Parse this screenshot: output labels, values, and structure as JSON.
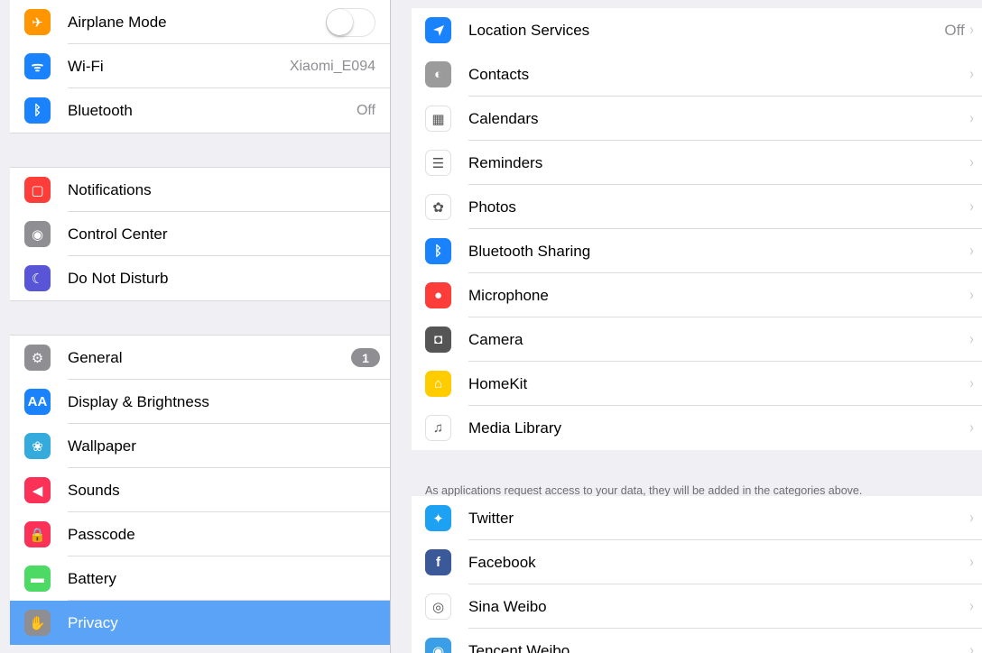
{
  "sidebar": {
    "group1": [
      {
        "label": "Airplane Mode",
        "icon": "airplane-icon",
        "color": "#ff9500",
        "glyph": "✈"
      },
      {
        "label": "Wi-Fi",
        "icon": "wifi-icon",
        "color": "#1a82fb",
        "glyph": "ᯤ",
        "value": "Xiaomi_E094"
      },
      {
        "label": "Bluetooth",
        "icon": "bluetooth-icon",
        "color": "#1a82fb",
        "glyph": "ᛒ",
        "value": "Off"
      }
    ],
    "group2": [
      {
        "label": "Notifications",
        "icon": "notifications-icon",
        "color": "#fc3d39",
        "glyph": "▢"
      },
      {
        "label": "Control Center",
        "icon": "control-center-icon",
        "color": "#8e8e93",
        "glyph": "◉"
      },
      {
        "label": "Do Not Disturb",
        "icon": "moon-icon",
        "color": "#5856d6",
        "glyph": "☾"
      }
    ],
    "group3": [
      {
        "label": "General",
        "icon": "gear-icon",
        "color": "#8e8e93",
        "glyph": "⚙",
        "badge": "1"
      },
      {
        "label": "Display & Brightness",
        "icon": "display-brightness-icon",
        "color": "#1a82fb",
        "glyph": "AA"
      },
      {
        "label": "Wallpaper",
        "icon": "wallpaper-icon",
        "color": "#35aadc",
        "glyph": "❀"
      },
      {
        "label": "Sounds",
        "icon": "speaker-icon",
        "color": "#fc3158",
        "glyph": "◀"
      },
      {
        "label": "Passcode",
        "icon": "lock-icon",
        "color": "#fc3158",
        "glyph": "🔒"
      },
      {
        "label": "Battery",
        "icon": "battery-icon",
        "color": "#4cd964",
        "glyph": "▬"
      },
      {
        "label": "Privacy",
        "icon": "hand-icon",
        "color": "#8e8e93",
        "glyph": "✋"
      }
    ]
  },
  "detail": {
    "location_services": {
      "label": "Location Services",
      "value": "Off"
    },
    "list": [
      {
        "label": "Contacts",
        "icon": "contacts-icon",
        "color": "#9b9b9b",
        "glyph": "◐"
      },
      {
        "label": "Calendars",
        "icon": "calendar-icon",
        "color": "#ffffff",
        "glyph": "▦"
      },
      {
        "label": "Reminders",
        "icon": "reminders-icon",
        "color": "#ffffff",
        "glyph": "☰"
      },
      {
        "label": "Photos",
        "icon": "photos-icon",
        "color": "#ffffff",
        "glyph": "✿"
      },
      {
        "label": "Bluetooth Sharing",
        "icon": "bluetooth-icon",
        "color": "#1a82fb",
        "glyph": "ᛒ"
      },
      {
        "label": "Microphone",
        "icon": "microphone-icon",
        "color": "#fc3d39",
        "glyph": "●"
      },
      {
        "label": "Camera",
        "icon": "camera-icon",
        "color": "#555555",
        "glyph": "◘"
      },
      {
        "label": "HomeKit",
        "icon": "homekit-icon",
        "color": "#ffcc00",
        "glyph": "⌂"
      },
      {
        "label": "Media Library",
        "icon": "music-icon",
        "color": "#ffffff",
        "glyph": "♫"
      }
    ],
    "footnote": "As applications request access to your data, they will be added in the categories above.",
    "social": [
      {
        "label": "Twitter",
        "icon": "twitter-icon",
        "color": "#1da1f2",
        "glyph": "✦"
      },
      {
        "label": "Facebook",
        "icon": "facebook-icon",
        "color": "#3b5998",
        "glyph": "f"
      },
      {
        "label": "Sina Weibo",
        "icon": "weibo-icon",
        "color": "#ffffff",
        "glyph": "◎"
      },
      {
        "label": "Tencent Weibo",
        "icon": "tencent-weibo-icon",
        "color": "#3b9fe8",
        "glyph": "◉"
      }
    ],
    "location_icon": {
      "icon": "location-arrow-icon",
      "color": "#1a82fb",
      "glyph": "➤"
    },
    "chevron": "›"
  },
  "colors": {
    "selected": "#5ba3f7",
    "background": "#efeff4"
  }
}
